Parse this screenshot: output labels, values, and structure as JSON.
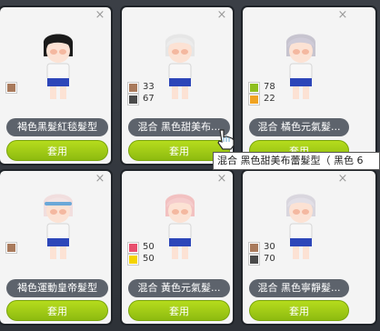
{
  "cards": [
    {
      "name": "褐色黑髮紅毯髮型",
      "button": "套用",
      "close": "×",
      "swatches": [
        {
          "color": "#a97a5c",
          "value": ""
        }
      ],
      "hair_color": "#1b1b1b"
    },
    {
      "name": "混合 黑色甜美布...",
      "button": "套用",
      "close": "×",
      "swatches": [
        {
          "color": "#a97a5c",
          "value": "33"
        },
        {
          "color": "#4a4a4a",
          "value": "67"
        }
      ],
      "hair_color": "#e6e6e6"
    },
    {
      "name": "混合 橘色元氣髮...",
      "button": "套用",
      "close": "×",
      "swatches": [
        {
          "color": "#8ebf1f",
          "value": "78"
        },
        {
          "color": "#f0a322",
          "value": "22"
        }
      ],
      "hair_color": "#c7c4cf"
    },
    {
      "name": "褐色運動皇帝髮型",
      "button": "套用",
      "close": "×",
      "swatches": [
        {
          "color": "#a97a5c",
          "value": ""
        }
      ],
      "hair_color": "#f1dede"
    },
    {
      "name": "混合 黃色元氣髮...",
      "button": "套用",
      "close": "×",
      "swatches": [
        {
          "color": "#e84f6e",
          "value": "50"
        },
        {
          "color": "#f4d300",
          "value": "50"
        }
      ],
      "hair_color": "#f2c1c1"
    },
    {
      "name": "混合 黑色寧靜髮...",
      "button": "套用",
      "close": "×",
      "swatches": [
        {
          "color": "#a97a5c",
          "value": "30"
        },
        {
          "color": "#4a4a4a",
          "value": "70"
        }
      ],
      "hair_color": "#d9d6de"
    }
  ],
  "tooltip": "混合 黑色甜美布蕾髮型（ 黑色 6"
}
